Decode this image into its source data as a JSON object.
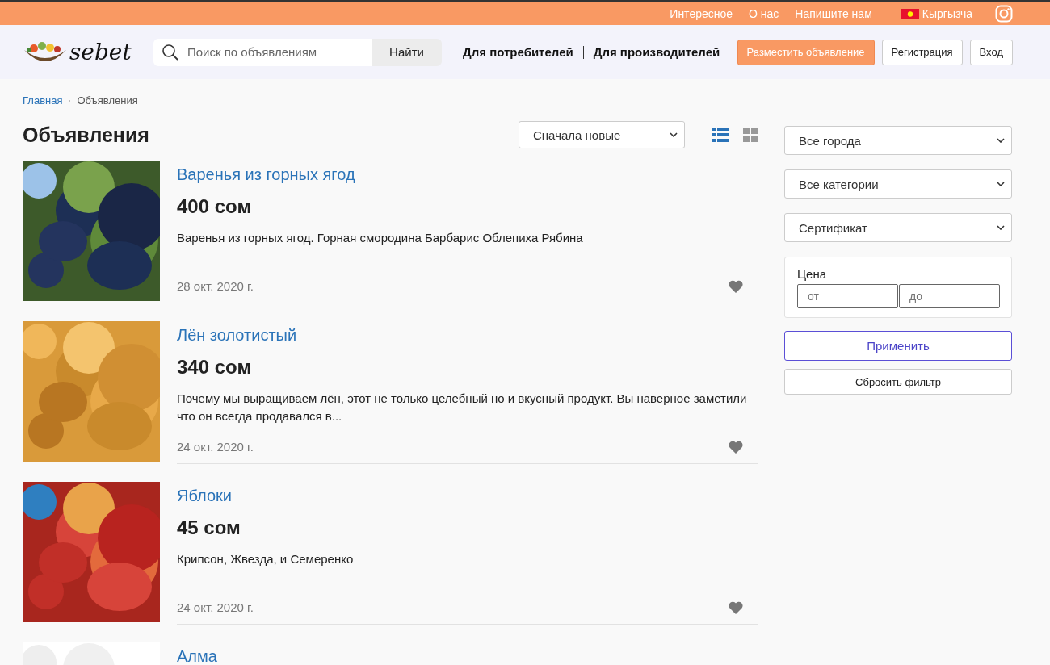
{
  "top_bar": {
    "links": [
      "Интересное",
      "О нас",
      "Напишите нам"
    ],
    "language": "Кыргызча"
  },
  "header": {
    "logo": "sebet",
    "search": {
      "placeholder": "Поиск по объявлениям",
      "button": "Найти"
    },
    "nav": [
      "Для потребителей",
      "Для производителей"
    ],
    "post_button": "Разместить объявление",
    "register_button": "Регистрация",
    "login_button": "Вход"
  },
  "breadcrumbs": [
    {
      "label": "Главная",
      "kind": "link"
    },
    {
      "label": "Объявления",
      "kind": "current"
    }
  ],
  "page_title": "Объявления",
  "sort": {
    "value": "Сначала новые"
  },
  "view_modes": [
    {
      "kind": "list",
      "selected": true
    },
    {
      "kind": "grid",
      "selected": false
    }
  ],
  "listings": [
    {
      "title": "Варенья из горных ягод",
      "price": "400 сом",
      "description": "Варенья из горных ягод. Горная смородина Барбарис Облепиха Рябина",
      "date": "28 окт. 2020 г."
    },
    {
      "title": "Лён золотистый",
      "price": "340 сом",
      "description": "Почему мы выращиваем лён, этот не только целебный но и вкусный продукт. Вы наверное заметили что он всегда продавался в...",
      "date": "24 окт. 2020 г."
    },
    {
      "title": "Яблоки",
      "price": "45 сом",
      "description": "Крипсон, Жвезда, и Семеренко",
      "date": "24 окт. 2020 г."
    },
    {
      "title": "Алма"
    }
  ],
  "filters": {
    "city": "Все города",
    "category": "Все категории",
    "certificate": "Сертификат",
    "price": {
      "label": "Цена",
      "from_placeholder": "от",
      "to_placeholder": "до"
    },
    "apply_button": "Применить",
    "reset_button": "Сбросить фильтр"
  }
}
